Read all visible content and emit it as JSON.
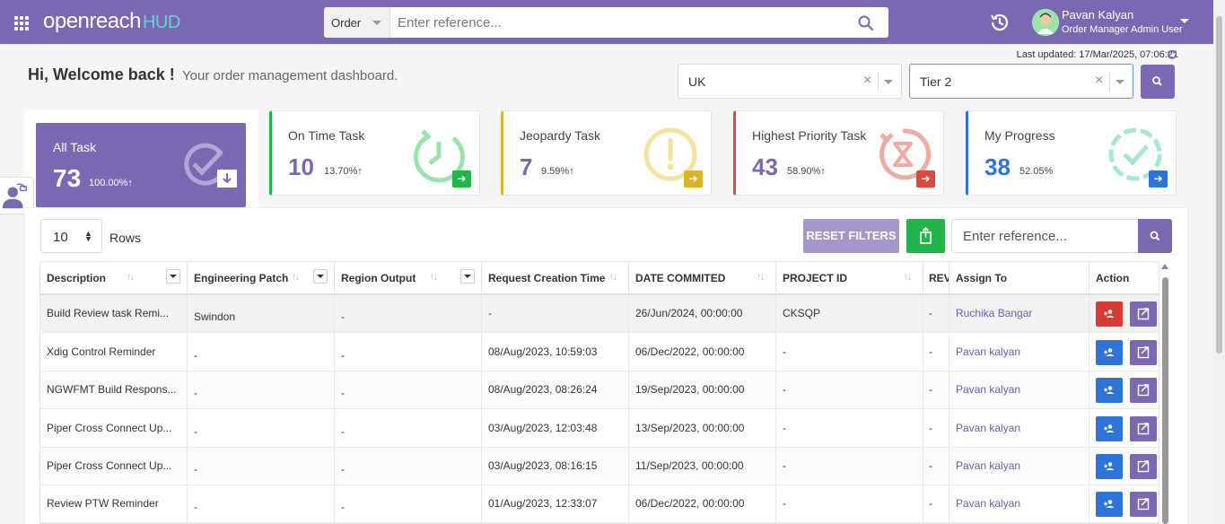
{
  "app": {
    "logo_main": "openreach",
    "logo_sub": "HUD"
  },
  "search": {
    "type": "Order",
    "placeholder": "Enter reference..."
  },
  "user": {
    "name": "Pavan Kalyan",
    "role": "Order Manager Admin User"
  },
  "last_updated": "Last updated: 17/Mar/2025, 07:06:21",
  "welcome": {
    "title": "Hi, Welcome back !",
    "subtitle": "Your order management dashboard."
  },
  "filters": {
    "region": "UK",
    "tier": "Tier 2"
  },
  "cards": {
    "all": {
      "title": "All Task",
      "count": "73",
      "pct": "100.00%↑"
    },
    "on_time": {
      "title": "On Time Task",
      "count": "10",
      "pct": "13.70%↑",
      "color": "#22b34a"
    },
    "jeopardy": {
      "title": "Jeopardy Task",
      "count": "7",
      "pct": "9.59%↑",
      "color": "#d9b32a"
    },
    "priority": {
      "title": "Highest Priority Task",
      "count": "43",
      "pct": "58.90%↑",
      "color": "#d64a3f"
    },
    "progress": {
      "title": "My Progress",
      "count": "38",
      "pct": "52.05%",
      "color": "#2e73d8"
    }
  },
  "table_controls": {
    "rows": "10",
    "rows_label": "Rows",
    "reset": "RESET FILTERS",
    "ref_placeholder": "Enter reference..."
  },
  "columns": {
    "description": "Description",
    "engineering_patch": "Engineering Patch",
    "region_output": "Region Output",
    "request_creation_time": "Request Creation Time",
    "date_commited": "DATE COMMITED",
    "project_id": "PROJECT ID",
    "rev": "REV",
    "assign_to": "Assign To",
    "action": "Action"
  },
  "rows": [
    {
      "description": "Build Review task Remi...",
      "patch": "Swindon",
      "region": "-",
      "created": "-",
      "committed": "26/Jun/2024, 00:00:00",
      "project": "CKSQP",
      "rev": "-",
      "assignee": "Ruchika Bangar"
    },
    {
      "description": "Xdig Control Reminder",
      "patch": "-",
      "region": "-",
      "created": "08/Aug/2023, 10:59:03",
      "committed": "06/Dec/2022, 00:00:00",
      "project": "-",
      "rev": "-",
      "assignee": "Pavan kalyan"
    },
    {
      "description": "NGWFMT Build Respons...",
      "patch": "-",
      "region": "-",
      "created": "08/Aug/2023, 08:26:24",
      "committed": "19/Sep/2023, 00:00:00",
      "project": "-",
      "rev": "-",
      "assignee": "Pavan kalyan"
    },
    {
      "description": "Piper Cross Connect Up...",
      "patch": "-",
      "region": "-",
      "created": "03/Aug/2023, 12:03:48",
      "committed": "13/Sep/2023, 00:00:00",
      "project": "-",
      "rev": "-",
      "assignee": "Pavan kalyan"
    },
    {
      "description": "Piper Cross Connect Up...",
      "patch": "-",
      "region": "-",
      "created": "03/Aug/2023, 08:16:15",
      "committed": "11/Sep/2023, 00:00:00",
      "project": "-",
      "rev": "-",
      "assignee": "Pavan kalyan"
    },
    {
      "description": "Review PTW Reminder",
      "patch": "-",
      "region": "-",
      "created": "01/Aug/2023, 12:33:07",
      "committed": "06/Dec/2022, 00:00:00",
      "project": "-",
      "rev": "-",
      "assignee": "Pavan kalyan"
    }
  ]
}
